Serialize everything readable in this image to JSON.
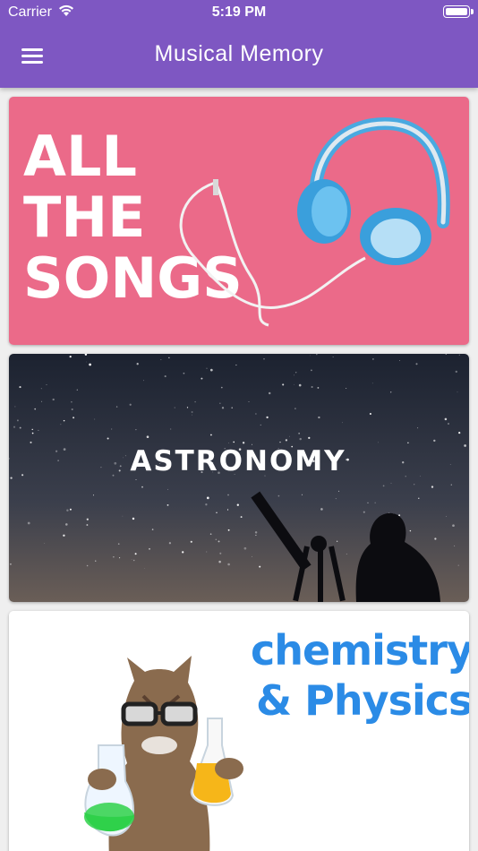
{
  "status_bar": {
    "carrier": "Carrier",
    "time": "5:19 PM"
  },
  "header": {
    "title": "Musical Memory",
    "menu_icon": "hamburger-menu-icon"
  },
  "categories": [
    {
      "lines": [
        "ALL",
        "THE",
        "SONGS"
      ],
      "background": "#e95f82",
      "art": "headphones"
    },
    {
      "label": "ASTRONOMY",
      "background": "#262b3a",
      "art": "telescope-stargazer"
    },
    {
      "lines": [
        "chemistry",
        "& Physics"
      ],
      "background": "#ffffff",
      "art": "cat-scientist",
      "text_color": "#2b8be6"
    }
  ],
  "colors": {
    "app_bar": "#7e57c2",
    "page": "#efefef"
  }
}
